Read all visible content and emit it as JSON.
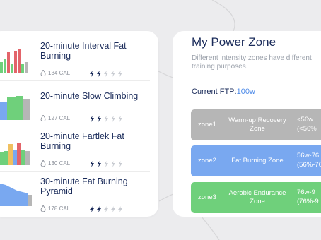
{
  "workouts": [
    {
      "title": "20-minute Interval Fat Burning",
      "cal": "134 CAL"
    },
    {
      "title": "20-minute Slow Climbing",
      "cal": "127 CAL"
    },
    {
      "title": "20-minute Fartlek Fat Burning",
      "cal": "130 CAL"
    },
    {
      "title": "30-minute Fat Burning Pyramid",
      "cal": "178 CAL"
    }
  ],
  "power_zone": {
    "title": "My Power Zone",
    "description": "Different intensity zones have different training purposes.",
    "ftp_label": "Current FTP:",
    "ftp_value": "100w",
    "zones": [
      {
        "name": "zone1",
        "label": "Warm-up Recovery Zone",
        "range": "<56w",
        "pct": "(<56%",
        "color": "#b6b6b6"
      },
      {
        "name": "zone2",
        "label": "Fat Burning Zone",
        "range": "56w-76",
        "pct": "(56%-76",
        "color": "#79a8f0"
      },
      {
        "name": "zone3",
        "label": "Aerobic Endurance Zone",
        "range": "76w-9",
        "pct": "(76%-9",
        "color": "#6fd07b"
      }
    ]
  },
  "colors": {
    "accent_blue": "#4d8ae8",
    "bolt_active": "#1a2b5a",
    "bolt_inactive": "#c9ccd2"
  }
}
